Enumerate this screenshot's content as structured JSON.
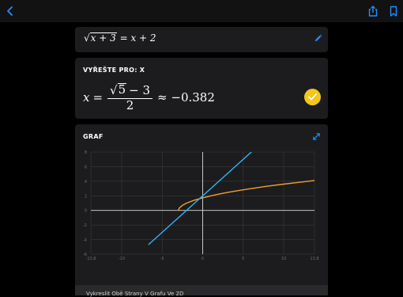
{
  "header": {
    "back_icon": "chevron-left-icon",
    "share_icon": "share-icon",
    "bookmark_icon": "bookmark-icon",
    "accent": "#1e90ff"
  },
  "equation": {
    "radicand": "x + 3",
    "rhs": "= x + 2",
    "edit_icon": "pencil-icon"
  },
  "solve": {
    "title": "VYŘEŠTE PRO: X",
    "variable": "x",
    "equals": "=",
    "numerator_radicand": "5",
    "numerator_rest": "− 3",
    "denominator": "2",
    "approx": "≈ −0.382",
    "check_icon": "checkmark-icon",
    "check_color": "#f5c518"
  },
  "graph": {
    "title": "GRAF",
    "expand_icon": "expand-icon",
    "caption": "Vykreslit Obě Strany V Grafu Ve 2D"
  },
  "chart_data": {
    "type": "line",
    "xlim": [
      -13.8,
      13.8
    ],
    "ylim": [
      -6,
      8
    ],
    "x_ticks": [
      -13.8,
      -10,
      -5,
      0,
      5,
      10,
      13.8
    ],
    "x_tick_labels": [
      "-13.8",
      "-10",
      "-5",
      "0",
      "5",
      "10",
      "13.8"
    ],
    "y_ticks": [
      -6,
      -4,
      -2,
      0,
      2,
      4,
      6,
      8
    ],
    "y_tick_labels": [
      "-6",
      "-4",
      "-2",
      "0",
      "2",
      "4",
      "6",
      "8"
    ],
    "grid": true,
    "series": [
      {
        "color": "#f0a030",
        "x": [
          -3,
          -2.9,
          -2.5,
          -2,
          -1,
          0,
          1,
          2,
          3,
          4,
          6,
          8,
          10,
          12,
          13.8
        ],
        "y": [
          0,
          0.32,
          0.71,
          1,
          1.41,
          1.73,
          2,
          2.24,
          2.45,
          2.65,
          3,
          3.32,
          3.61,
          3.87,
          4.1
        ]
      },
      {
        "color": "#29b6f6",
        "x": [
          -6.7,
          6.4
        ],
        "y": [
          -4.7,
          8.4
        ]
      }
    ]
  }
}
